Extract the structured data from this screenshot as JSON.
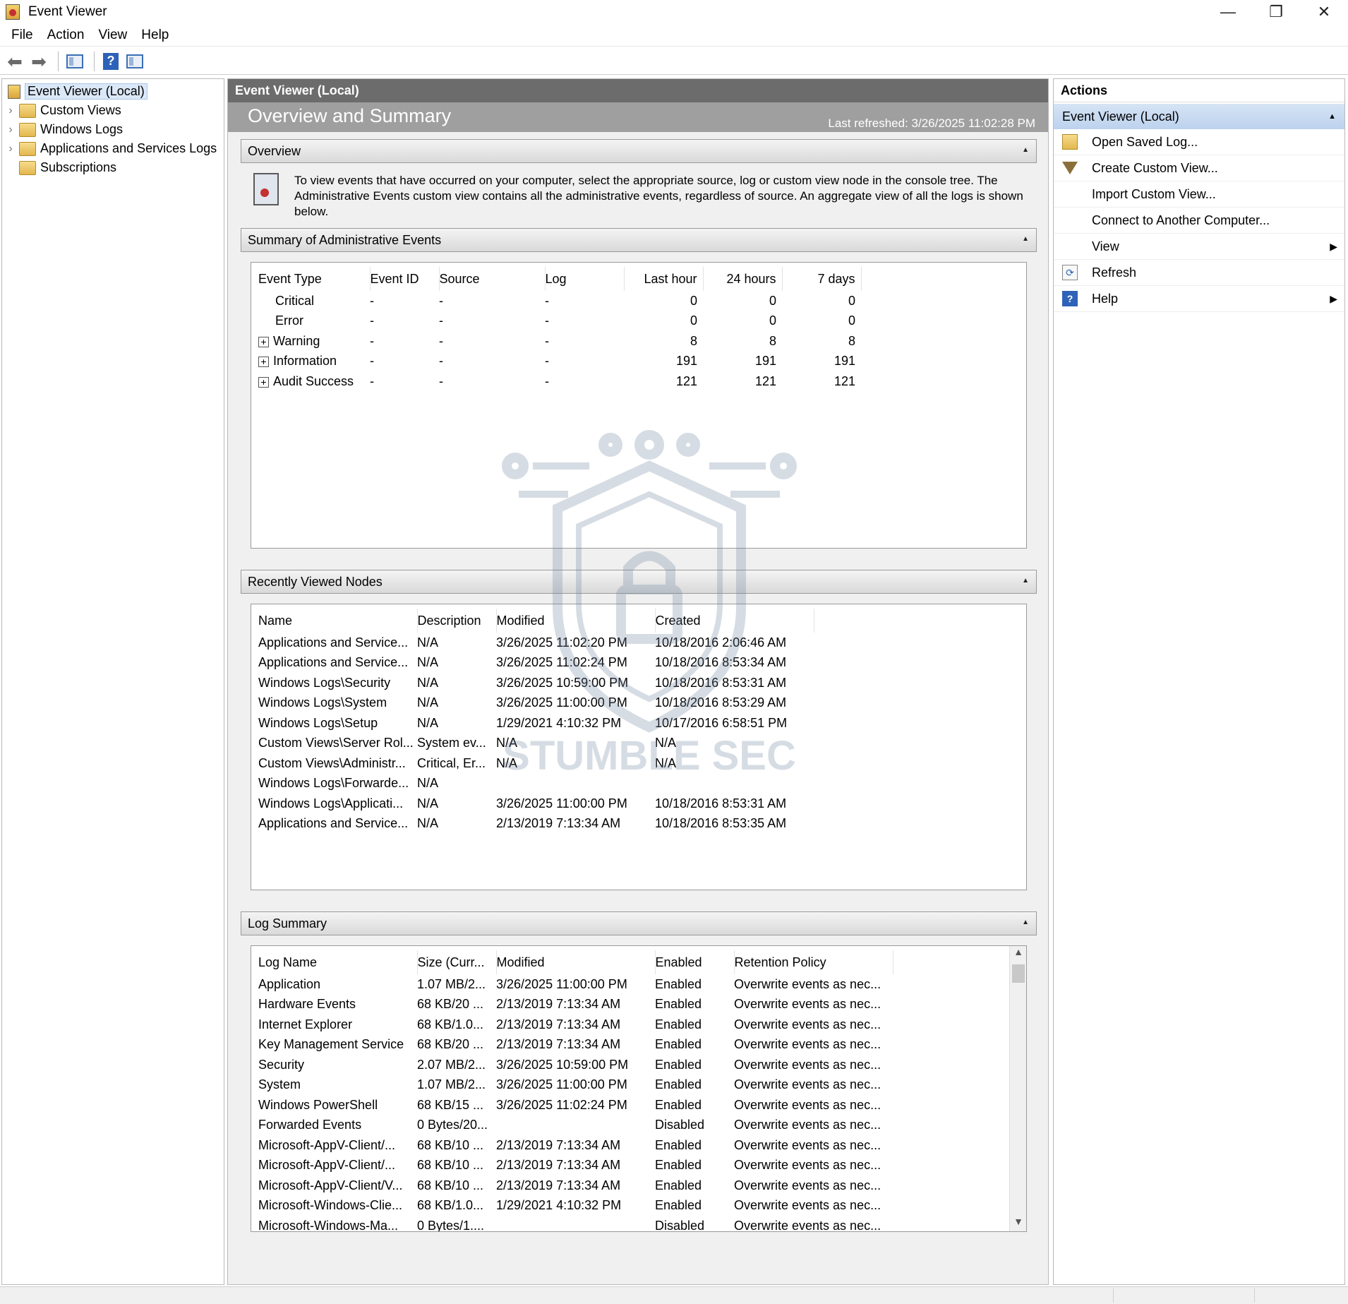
{
  "window": {
    "title": "Event Viewer",
    "controls": {
      "minimize": "—",
      "restore": "❐",
      "close": "✕"
    }
  },
  "menu": [
    "File",
    "Action",
    "View",
    "Help"
  ],
  "toolbar": {
    "back_icon": "back-arrow-icon",
    "forward_icon": "forward-arrow-icon",
    "help_glyph": "?"
  },
  "tree": {
    "root": "Event Viewer (Local)",
    "children": [
      "Custom Views",
      "Windows Logs",
      "Applications and Services Logs",
      "Subscriptions"
    ]
  },
  "center": {
    "header": "Event Viewer (Local)",
    "banner_title": "Overview and Summary",
    "last_refreshed": "Last refreshed: 3/26/2025 11:02:28 PM",
    "overview": {
      "heading": "Overview",
      "text": "To view events that have occurred on your computer, select the appropriate source, log or custom view node in the console tree. The Administrative Events custom view contains all the administrative events, regardless of source. An aggregate view of all the logs is shown below."
    },
    "summary": {
      "heading": "Summary of Administrative Events",
      "columns": [
        "Event Type",
        "Event ID",
        "Source",
        "Log",
        "Last hour",
        "24 hours",
        "7 days"
      ],
      "rows": [
        {
          "type": "Critical",
          "expandable": false,
          "event_id": "-",
          "source": "-",
          "log": "-",
          "last_hour": "0",
          "h24": "0",
          "d7": "0"
        },
        {
          "type": "Error",
          "expandable": false,
          "event_id": "-",
          "source": "-",
          "log": "-",
          "last_hour": "0",
          "h24": "0",
          "d7": "0"
        },
        {
          "type": "Warning",
          "expandable": true,
          "event_id": "-",
          "source": "-",
          "log": "-",
          "last_hour": "8",
          "h24": "8",
          "d7": "8"
        },
        {
          "type": "Information",
          "expandable": true,
          "event_id": "-",
          "source": "-",
          "log": "-",
          "last_hour": "191",
          "h24": "191",
          "d7": "191"
        },
        {
          "type": "Audit Success",
          "expandable": true,
          "event_id": "-",
          "source": "-",
          "log": "-",
          "last_hour": "121",
          "h24": "121",
          "d7": "121"
        }
      ]
    },
    "recent": {
      "heading": "Recently Viewed Nodes",
      "columns": [
        "Name",
        "Description",
        "Modified",
        "Created"
      ],
      "rows": [
        [
          "Applications and Service...",
          "N/A",
          "3/26/2025 11:02:20 PM",
          "10/18/2016 2:06:46 AM"
        ],
        [
          "Applications and Service...",
          "N/A",
          "3/26/2025 11:02:24 PM",
          "10/18/2016 8:53:34 AM"
        ],
        [
          "Windows Logs\\Security",
          "N/A",
          "3/26/2025 10:59:00 PM",
          "10/18/2016 8:53:31 AM"
        ],
        [
          "Windows Logs\\System",
          "N/A",
          "3/26/2025 11:00:00 PM",
          "10/18/2016 8:53:29 AM"
        ],
        [
          "Windows Logs\\Setup",
          "N/A",
          "1/29/2021 4:10:32 PM",
          "10/17/2016 6:58:51 PM"
        ],
        [
          "Custom Views\\Server Rol...",
          "System ev...",
          "N/A",
          "N/A"
        ],
        [
          "Custom Views\\Administr...",
          "Critical, Er...",
          "N/A",
          "N/A"
        ],
        [
          "Windows Logs\\Forwarde...",
          "N/A",
          "",
          ""
        ],
        [
          "Windows Logs\\Applicati...",
          "N/A",
          "3/26/2025 11:00:00 PM",
          "10/18/2016 8:53:31 AM"
        ],
        [
          "Applications and Service...",
          "N/A",
          "2/13/2019 7:13:34 AM",
          "10/18/2016 8:53:35 AM"
        ]
      ]
    },
    "log_summary": {
      "heading": "Log Summary",
      "columns": [
        "Log Name",
        "Size (Curr...",
        "Modified",
        "Enabled",
        "Retention Policy"
      ],
      "rows": [
        [
          "Application",
          "1.07 MB/2...",
          "3/26/2025 11:00:00 PM",
          "Enabled",
          "Overwrite events as nec..."
        ],
        [
          "Hardware Events",
          "68 KB/20 ...",
          "2/13/2019 7:13:34 AM",
          "Enabled",
          "Overwrite events as nec..."
        ],
        [
          "Internet Explorer",
          "68 KB/1.0...",
          "2/13/2019 7:13:34 AM",
          "Enabled",
          "Overwrite events as nec..."
        ],
        [
          "Key Management Service",
          "68 KB/20 ...",
          "2/13/2019 7:13:34 AM",
          "Enabled",
          "Overwrite events as nec..."
        ],
        [
          "Security",
          "2.07 MB/2...",
          "3/26/2025 10:59:00 PM",
          "Enabled",
          "Overwrite events as nec..."
        ],
        [
          "System",
          "1.07 MB/2...",
          "3/26/2025 11:00:00 PM",
          "Enabled",
          "Overwrite events as nec..."
        ],
        [
          "Windows PowerShell",
          "68 KB/15 ...",
          "3/26/2025 11:02:24 PM",
          "Enabled",
          "Overwrite events as nec..."
        ],
        [
          "Forwarded Events",
          "0 Bytes/20...",
          "",
          "Disabled",
          "Overwrite events as nec..."
        ],
        [
          "Microsoft-AppV-Client/...",
          "68 KB/10 ...",
          "2/13/2019 7:13:34 AM",
          "Enabled",
          "Overwrite events as nec..."
        ],
        [
          "Microsoft-AppV-Client/...",
          "68 KB/10 ...",
          "2/13/2019 7:13:34 AM",
          "Enabled",
          "Overwrite events as nec..."
        ],
        [
          "Microsoft-AppV-Client/V...",
          "68 KB/10 ...",
          "2/13/2019 7:13:34 AM",
          "Enabled",
          "Overwrite events as nec..."
        ],
        [
          "Microsoft-Windows-Clie...",
          "68 KB/1.0...",
          "1/29/2021 4:10:32 PM",
          "Enabled",
          "Overwrite events as nec..."
        ],
        [
          "Microsoft-Windows-Ma...",
          "0 Bytes/1....",
          "",
          "Disabled",
          "Overwrite events as nec..."
        ]
      ]
    }
  },
  "actions": {
    "title": "Actions",
    "group": "Event Viewer (Local)",
    "items": [
      {
        "label": "Open Saved Log...",
        "icon": "open-folder-icon",
        "submenu": false
      },
      {
        "label": "Create Custom View...",
        "icon": "filter-icon",
        "submenu": false
      },
      {
        "label": "Import Custom View...",
        "icon": "",
        "submenu": false
      },
      {
        "label": "Connect to Another Computer...",
        "icon": "",
        "submenu": false
      },
      {
        "label": "View",
        "icon": "",
        "submenu": true
      },
      {
        "label": "Refresh",
        "icon": "refresh-icon",
        "submenu": false
      },
      {
        "label": "Help",
        "icon": "help-icon",
        "submenu": true
      }
    ]
  },
  "watermark": {
    "text": "STUMBLE SEC",
    "color": "#8a9bb0"
  }
}
